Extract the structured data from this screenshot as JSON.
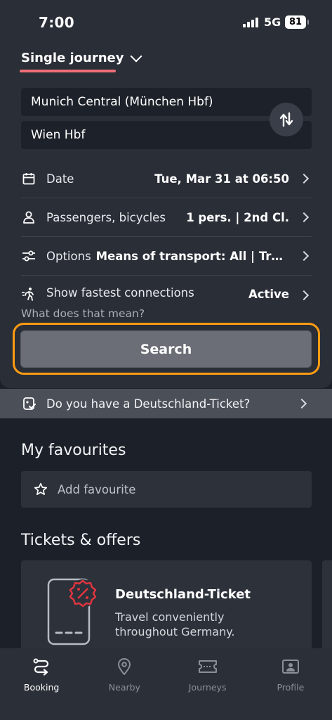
{
  "status_bar": {
    "time": "7:00",
    "network": "5G",
    "battery": "81"
  },
  "journey": {
    "type_label": "Single journey",
    "from": "Munich Central (München Hbf)",
    "to": "Wien Hbf"
  },
  "options": {
    "date": {
      "label": "Date",
      "value": "Tue, Mar 31 at 06:50"
    },
    "passengers": {
      "label": "Passengers, bicycles",
      "value": "1 pers. | 2nd Cl."
    },
    "transport": {
      "label": "Options",
      "value": "Means of transport: All | Transfers"
    },
    "fastest": {
      "label": "Show fastest connections",
      "value": "Active",
      "help": "What does that mean?"
    }
  },
  "search_label": "Search",
  "dticket_banner": "Do you have a Deutschland-Ticket?",
  "favourites": {
    "title": "My favourites",
    "add_label": "Add favourite"
  },
  "offers": {
    "title": "Tickets & offers",
    "card_title": "Deutschland-Ticket",
    "card_desc": "Travel conveniently throughout Germany."
  },
  "nav": [
    {
      "label": "Booking",
      "icon": "booking-icon",
      "active": true
    },
    {
      "label": "Nearby",
      "icon": "location-pin-icon",
      "active": false
    },
    {
      "label": "Journeys",
      "icon": "ticket-icon",
      "active": false
    },
    {
      "label": "Profile",
      "icon": "profile-icon",
      "active": false
    }
  ],
  "colors": {
    "accent": "#ef6f77",
    "highlight": "#ff9c12",
    "background": "#1c2029",
    "card": "#2a2e37"
  }
}
